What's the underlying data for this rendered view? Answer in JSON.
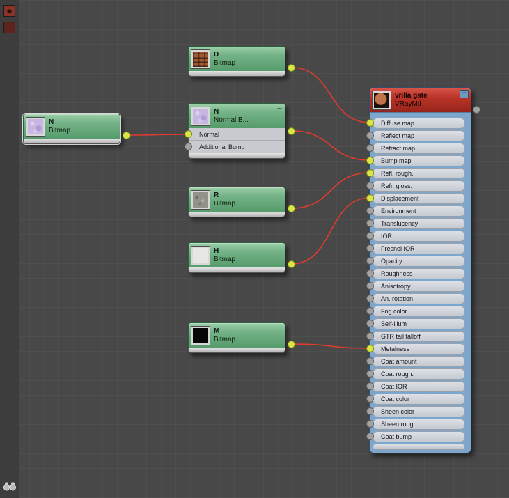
{
  "ui": {
    "colors": {
      "background": "#484848",
      "grid": "#545454",
      "wire": "#e23b2e",
      "socket_connected": "#d9e647",
      "socket_empty": "#a3a3a3",
      "bitmap_header_green": "#6fae81",
      "material_header_red": "#b22a20",
      "material_body_blue": "#7ca6cb"
    },
    "icons": [
      "toolbar-red-icon",
      "toolbar-darkred-icon",
      "binoculars-icon",
      "minimize-dash-icon",
      "output-socket",
      "input-socket"
    ]
  },
  "nodes": {
    "bitmap_d": {
      "title": "D",
      "type": "Bitmap"
    },
    "bitmap_n": {
      "title": "N",
      "type": "Bitmap"
    },
    "normal_bump": {
      "title": "N",
      "type": "Normal B...",
      "minimize": "−",
      "inputs": [
        {
          "label": "Normal",
          "connected": true
        },
        {
          "label": "Additional Bump",
          "connected": false
        }
      ]
    },
    "bitmap_r": {
      "title": "R",
      "type": "Bitmap"
    },
    "bitmap_h": {
      "title": "H",
      "type": "Bitmap"
    },
    "bitmap_m": {
      "title": "M",
      "type": "Bitmap"
    },
    "vraymtl": {
      "title": "vrilla gate",
      "type": "VRayMtl",
      "minimize": "−",
      "inputs": [
        {
          "label": "Diffuse map",
          "connected": true
        },
        {
          "label": "Reflect map",
          "connected": false
        },
        {
          "label": "Refract map",
          "connected": false
        },
        {
          "label": "Bump map",
          "connected": true
        },
        {
          "label": "Refl. rough.",
          "connected": true
        },
        {
          "label": "Refr. gloss.",
          "connected": false
        },
        {
          "label": "Displacement",
          "connected": true
        },
        {
          "label": "Environment",
          "connected": false
        },
        {
          "label": "Translucency",
          "connected": false
        },
        {
          "label": "IOR",
          "connected": false
        },
        {
          "label": "Fresnel IOR",
          "connected": false
        },
        {
          "label": "Opacity",
          "connected": false
        },
        {
          "label": "Roughness",
          "connected": false
        },
        {
          "label": "Anisotropy",
          "connected": false
        },
        {
          "label": "An. rotation",
          "connected": false
        },
        {
          "label": "Fog color",
          "connected": false
        },
        {
          "label": "Self-illum",
          "connected": false
        },
        {
          "label": "GTR tail falloff",
          "connected": false
        },
        {
          "label": "Metalness",
          "connected": true
        },
        {
          "label": "Coat amount",
          "connected": false
        },
        {
          "label": "Coat rough.",
          "connected": false
        },
        {
          "label": "Coat IOR",
          "connected": false
        },
        {
          "label": "Coat color",
          "connected": false
        },
        {
          "label": "Sheen color",
          "connected": false
        },
        {
          "label": "Sheen rough.",
          "connected": false
        },
        {
          "label": "Coat bump",
          "connected": false
        }
      ]
    }
  },
  "connections": [
    {
      "from": "bitmap_d.out",
      "to": "vraymtl.in.diffuse"
    },
    {
      "from": "bitmap_n.out",
      "to": "normal_bump.in.normal"
    },
    {
      "from": "normal_bump.out",
      "to": "vraymtl.in.bump"
    },
    {
      "from": "bitmap_r.out",
      "to": "vraymtl.in.refl_rough"
    },
    {
      "from": "bitmap_h.out",
      "to": "vraymtl.in.displacement"
    },
    {
      "from": "bitmap_m.out",
      "to": "vraymtl.in.metalness"
    }
  ]
}
